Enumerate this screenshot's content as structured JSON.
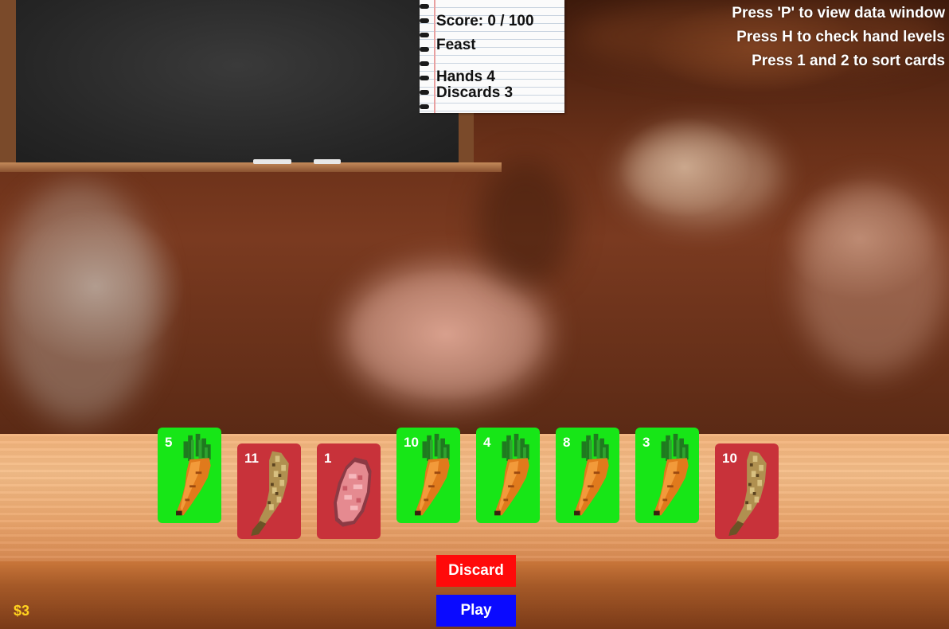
{
  "scoreboard": {
    "score": "Score: 0 / 100",
    "blind_name": "Feast",
    "hands": "Hands 4",
    "discards": "Discards 3"
  },
  "help": {
    "line1": "Press 'P' to view data window",
    "line2": "Press H to check hand levels",
    "line3": "Press 1 and 2 to sort cards"
  },
  "hand": [
    {
      "value": "5",
      "ingredient": "carrot",
      "color": "#17e617",
      "selected": true
    },
    {
      "value": "11",
      "ingredient": "wheat",
      "color": "#c8323a",
      "selected": false
    },
    {
      "value": "1",
      "ingredient": "meat",
      "color": "#c8323a",
      "selected": false
    },
    {
      "value": "10",
      "ingredient": "carrot",
      "color": "#17e617",
      "selected": true
    },
    {
      "value": "4",
      "ingredient": "carrot",
      "color": "#17e617",
      "selected": true
    },
    {
      "value": "8",
      "ingredient": "carrot",
      "color": "#17e617",
      "selected": true
    },
    {
      "value": "3",
      "ingredient": "carrot",
      "color": "#17e617",
      "selected": true
    },
    {
      "value": "10",
      "ingredient": "wheat",
      "color": "#c8323a",
      "selected": false
    }
  ],
  "buttons": {
    "discard_label": "Discard",
    "play_label": "Play"
  },
  "money": "$3"
}
